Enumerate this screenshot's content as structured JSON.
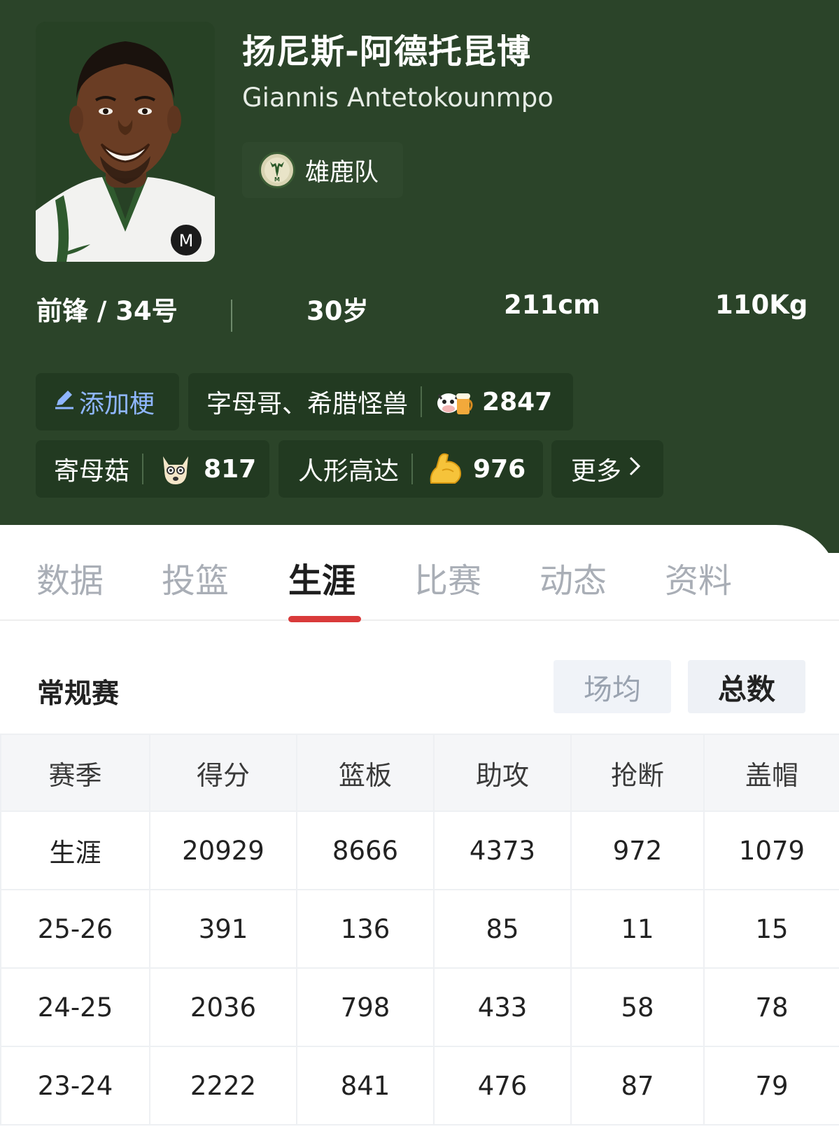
{
  "player": {
    "name_cn": "扬尼斯-阿德托昆博",
    "name_en": "Giannis Antetokounmpo",
    "team": "雄鹿队",
    "position_number": "前锋 / 34号",
    "age": "30岁",
    "height": "211cm",
    "weight": "110Kg"
  },
  "tags": {
    "add_label": "添加梗",
    "items": [
      {
        "text": "字母哥、希腊怪兽",
        "count": "2847",
        "icon": "cow-beer-icon"
      },
      {
        "text": "寄母菇",
        "count": "817",
        "icon": "shocked-dog-icon"
      },
      {
        "text": "人形高达",
        "count": "976",
        "icon": "flexed-bicep-icon"
      }
    ],
    "more_label": "更多"
  },
  "tabs": [
    {
      "label": "数据"
    },
    {
      "label": "投篮"
    },
    {
      "label": "生涯"
    },
    {
      "label": "比赛"
    },
    {
      "label": "动态"
    },
    {
      "label": "资料"
    }
  ],
  "active_tab": "生涯",
  "section": {
    "title": "常规赛",
    "toggle_avg": "场均",
    "toggle_total": "总数",
    "selected_toggle": "总数"
  },
  "table": {
    "headers": [
      "赛季",
      "得分",
      "篮板",
      "助攻",
      "抢断",
      "盖帽"
    ],
    "rows": [
      [
        "生涯",
        "20929",
        "8666",
        "4373",
        "972",
        "1079"
      ],
      [
        "25-26",
        "391",
        "136",
        "85",
        "11",
        "15"
      ],
      [
        "24-25",
        "2036",
        "798",
        "433",
        "58",
        "78"
      ],
      [
        "23-24",
        "2222",
        "841",
        "476",
        "87",
        "79"
      ]
    ]
  },
  "colors": {
    "header_bg": "#2b4429",
    "tab_underline": "#d93a3a",
    "add_tag_text": "#8fb6ff"
  }
}
